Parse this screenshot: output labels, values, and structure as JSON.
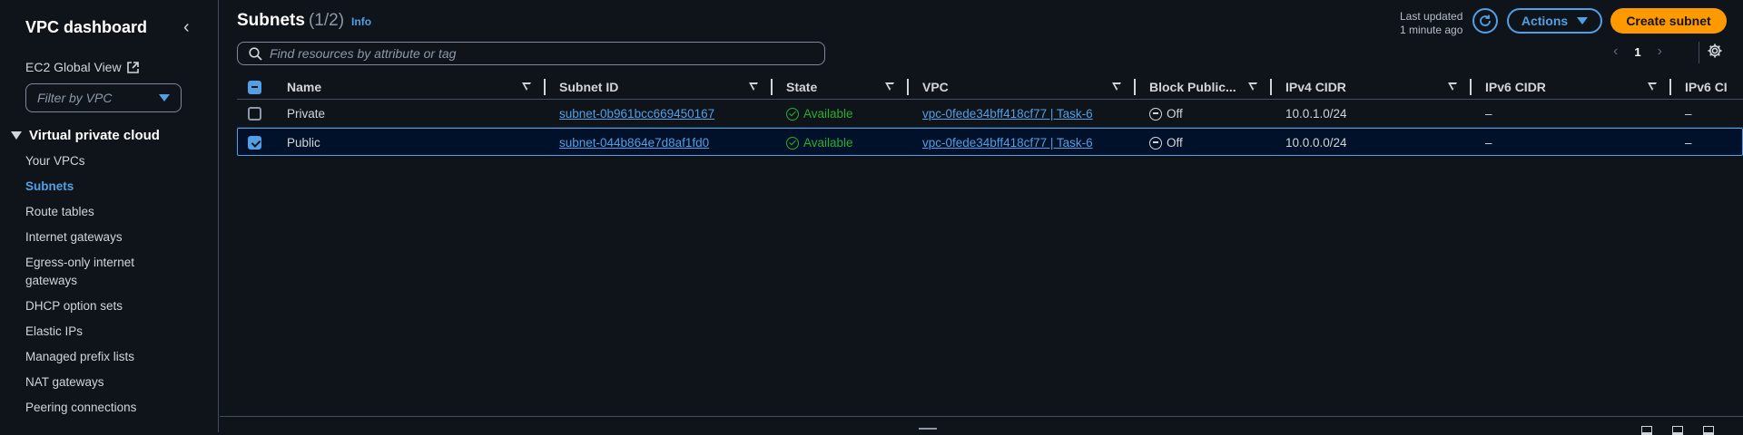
{
  "sidebar": {
    "title": "VPC dashboard",
    "ec2_global_view": "EC2 Global View",
    "filter_placeholder": "Filter by VPC",
    "section_title": "Virtual private cloud",
    "items": [
      {
        "label": "Your VPCs",
        "active": false
      },
      {
        "label": "Subnets",
        "active": true
      },
      {
        "label": "Route tables",
        "active": false
      },
      {
        "label": "Internet gateways",
        "active": false
      },
      {
        "label": "Egress-only internet gateways",
        "active": false
      },
      {
        "label": "DHCP option sets",
        "active": false
      },
      {
        "label": "Elastic IPs",
        "active": false
      },
      {
        "label": "Managed prefix lists",
        "active": false
      },
      {
        "label": "NAT gateways",
        "active": false
      },
      {
        "label": "Peering connections",
        "active": false
      }
    ]
  },
  "header": {
    "title": "Subnets",
    "count": "(1/2)",
    "info": "Info",
    "last_updated_line1": "Last updated",
    "last_updated_line2": "1 minute ago",
    "actions_label": "Actions",
    "create_label": "Create subnet"
  },
  "search": {
    "placeholder": "Find resources by attribute or tag"
  },
  "pagination": {
    "current_page": "1"
  },
  "table": {
    "columns": [
      "Name",
      "Subnet ID",
      "State",
      "VPC",
      "Block Public...",
      "IPv4 CIDR",
      "IPv6 CIDR",
      "IPv6 CI"
    ],
    "rows": [
      {
        "selected": false,
        "name": "Private",
        "subnet_id": "subnet-0b961bcc669450167",
        "state": "Available",
        "vpc": "vpc-0fede34bff418cf77 | Task-6",
        "block_public": "Off",
        "ipv4_cidr": "10.0.1.0/24",
        "ipv6_cidr": "–",
        "ipv6_ci": "–"
      },
      {
        "selected": true,
        "name": "Public",
        "subnet_id": "subnet-044b864e7d8af1fd0",
        "state": "Available",
        "vpc": "vpc-0fede34bff418cf77 | Task-6",
        "block_public": "Off",
        "ipv4_cidr": "10.0.0.0/24",
        "ipv6_cidr": "–",
        "ipv6_ci": "–"
      }
    ]
  },
  "colors": {
    "accent": "#539fe5",
    "primary_button": "#ff9900",
    "status_available": "#29ad32",
    "background": "#0f141a"
  }
}
